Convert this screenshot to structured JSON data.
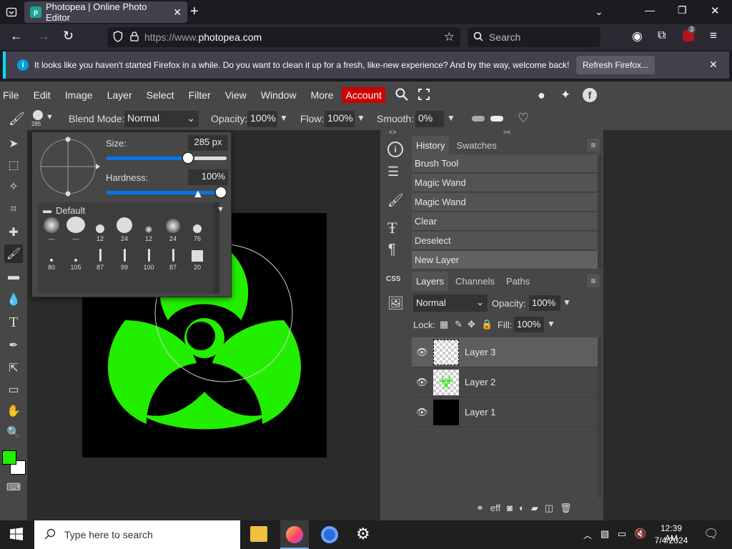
{
  "browser": {
    "tab_title": "Photopea | Online Photo Editor",
    "url_prefix": "https://www.",
    "url_domain": "photopea.com",
    "search_placeholder": "Search",
    "extension_badge": "3"
  },
  "notification": {
    "message": "It looks like you haven't started Firefox in a while. Do you want to clean it up for a fresh, like-new experience? And by the way, welcome back!",
    "button": "Refresh Firefox..."
  },
  "menu": {
    "items": [
      "File",
      "Edit",
      "Image",
      "Layer",
      "Select",
      "Filter",
      "View",
      "Window",
      "More"
    ],
    "account": "Account",
    "account_color": "#cc0000"
  },
  "options": {
    "brush_size_badge": "285",
    "blend_label": "Blend Mode:",
    "blend_value": "Normal",
    "opacity_label": "Opacity:",
    "opacity_value": "100%",
    "flow_label": "Flow:",
    "flow_value": "100%",
    "smooth_label": "Smooth:",
    "smooth_value": "0%"
  },
  "brush_popup": {
    "size_label": "Size:",
    "size_value": "285",
    "size_unit": "px",
    "size_fraction": 0.68,
    "hardness_label": "Hardness:",
    "hardness_value": "100%",
    "hardness_fraction": 1.0,
    "folder_name": "Default",
    "presets": [
      "—",
      "—",
      "12",
      "24",
      "12",
      "24",
      "76",
      "80",
      "105",
      "87",
      "99",
      "100",
      "87",
      "20"
    ]
  },
  "history": {
    "tabs": [
      "History",
      "Swatches"
    ],
    "items": [
      "Brush Tool",
      "Magic Wand",
      "Magic Wand",
      "Clear",
      "Deselect",
      "New Layer"
    ]
  },
  "layers": {
    "tabs": [
      "Layers",
      "Channels",
      "Paths"
    ],
    "blend_value": "Normal",
    "opacity_label": "Opacity:",
    "opacity_value": "100%",
    "lock_label": "Lock:",
    "fill_label": "Fill:",
    "fill_value": "100%",
    "items": [
      {
        "name": "Layer 3",
        "selected": true
      },
      {
        "name": "Layer 2",
        "selected": false
      },
      {
        "name": "Layer 1",
        "selected": false
      }
    ]
  },
  "midcol": {
    "css_label": "CSS"
  },
  "colors": {
    "foreground": "#22ee00",
    "background": "#ffffff",
    "accent": "#0077e6"
  },
  "taskbar": {
    "search_placeholder": "Type here to search",
    "time": "12:39 AM",
    "date": "7/4/2024"
  }
}
